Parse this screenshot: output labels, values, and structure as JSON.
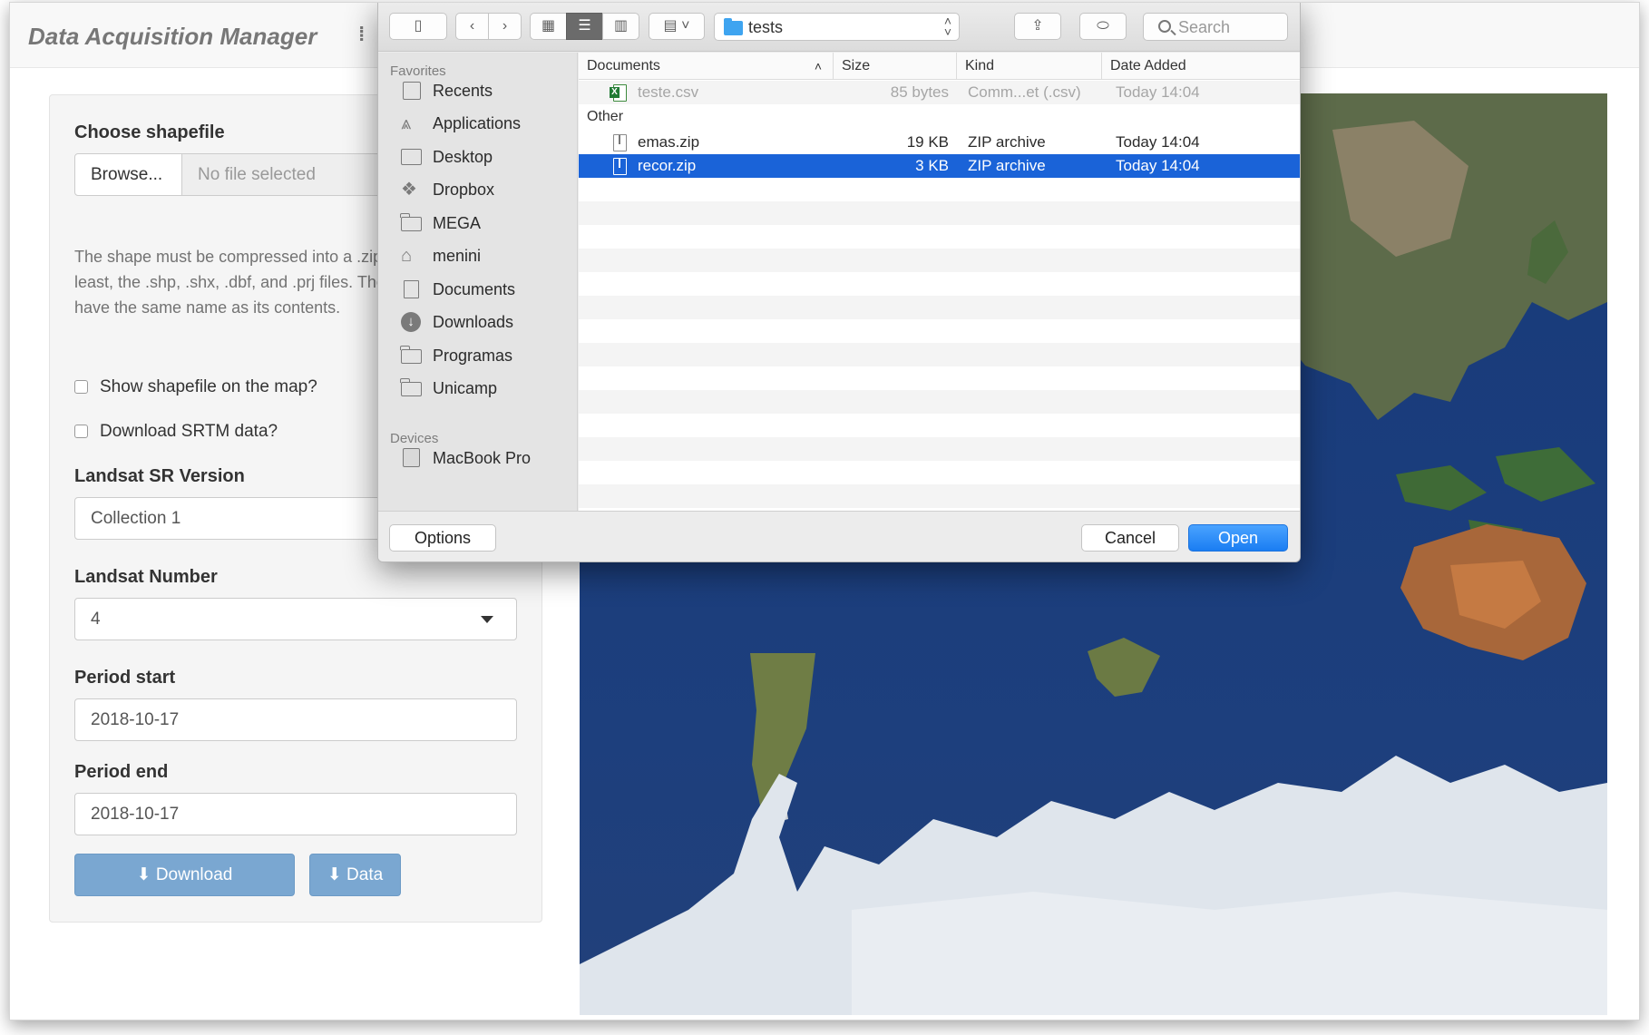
{
  "app": {
    "title": "Data Acquisition Manager"
  },
  "sidebar": {
    "shapefile_label": "Choose shapefile",
    "browse_label": "Browse...",
    "file_placeholder": "No file selected",
    "help_text": "The shape must be compressed into a .zip file containing, at least, the .shp, .shx, .dbf, and .prj files. The .zip file must have the same name as its contents.",
    "show_shapefile_label": "Show shapefile on the map?",
    "show_shapefile_checked": false,
    "download_srtm_label": "Download SRTM data?",
    "download_srtm_checked": false,
    "landsat_version_label": "Landsat SR Version",
    "landsat_version_value": "Collection 1",
    "landsat_number_label": "Landsat Number",
    "landsat_number_value": "4",
    "period_start_label": "Period start",
    "period_start_value": "2018-10-17",
    "period_end_label": "Period end",
    "period_end_value": "2018-10-17",
    "download_button": "⬇ Download",
    "data_button": "⬇ Data"
  },
  "dialog": {
    "path_folder": "tests",
    "search_placeholder": "Search",
    "sidebar": {
      "favorites_heading": "Favorites",
      "favorites": [
        {
          "label": "Recents",
          "icon": "recents-icon"
        },
        {
          "label": "Applications",
          "icon": "applications-icon"
        },
        {
          "label": "Desktop",
          "icon": "desktop-icon"
        },
        {
          "label": "Dropbox",
          "icon": "dropbox-icon"
        },
        {
          "label": "MEGA",
          "icon": "folder-icon"
        },
        {
          "label": "menini",
          "icon": "home-icon"
        },
        {
          "label": "Documents",
          "icon": "documents-icon"
        },
        {
          "label": "Downloads",
          "icon": "downloads-icon"
        },
        {
          "label": "Programas",
          "icon": "folder-icon"
        },
        {
          "label": "Unicamp",
          "icon": "folder-icon"
        }
      ],
      "devices_heading": "Devices",
      "devices": [
        {
          "label": "MacBook Pro",
          "icon": "disk-icon"
        }
      ]
    },
    "columns": {
      "name": "Documents",
      "size": "Size",
      "kind": "Kind",
      "date": "Date Added"
    },
    "files_top": [
      {
        "name": "teste.csv",
        "size": "85 bytes",
        "kind": "Comm...et (.csv)",
        "date": "Today 14:04",
        "disabled": true
      }
    ],
    "group_other": "Other",
    "files_other": [
      {
        "name": "emas.zip",
        "size": "19 KB",
        "kind": "ZIP archive",
        "date": "Today 14:04",
        "selected": false
      },
      {
        "name": "recor.zip",
        "size": "3 KB",
        "kind": "ZIP archive",
        "date": "Today 14:04",
        "selected": true
      }
    ],
    "options_button": "Options",
    "cancel_button": "Cancel",
    "open_button": "Open"
  },
  "colors": {
    "selection": "#1a63d8",
    "primary_button": "#7aa7d1",
    "ocean": "#1c3b78"
  }
}
